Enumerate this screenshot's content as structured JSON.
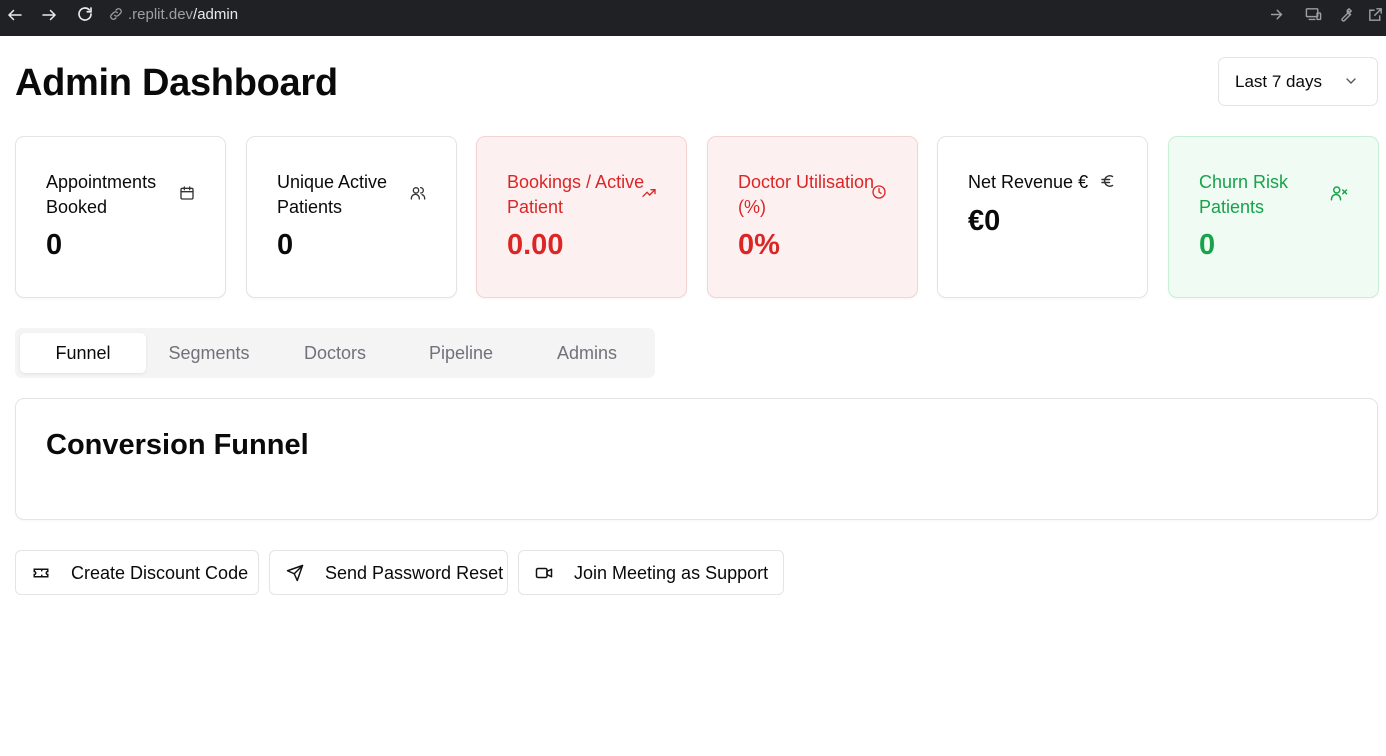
{
  "browser": {
    "url_host": ".replit.dev",
    "url_path": "/admin"
  },
  "header": {
    "title": "Admin Dashboard",
    "range": "Last 7 days"
  },
  "cards": [
    {
      "label": "Appointments Booked",
      "value": "0",
      "icon": "calendar-icon",
      "tone": "neutral"
    },
    {
      "label": "Unique Active Patients",
      "value": "0",
      "icon": "users-icon",
      "tone": "neutral"
    },
    {
      "label": "Bookings / Active Patient",
      "value": "0.00",
      "icon": "trending-up-icon",
      "tone": "red"
    },
    {
      "label": "Doctor Utilisation (%)",
      "value": "0%",
      "icon": "clock-icon",
      "tone": "red"
    },
    {
      "label": "Net Revenue €",
      "value": "€0",
      "icon": "euro-icon",
      "tone": "neutral"
    },
    {
      "label": "Churn Risk Patients",
      "value": "0",
      "icon": "user-x-icon",
      "tone": "green"
    }
  ],
  "tabs": [
    {
      "label": "Funnel",
      "active": true
    },
    {
      "label": "Segments",
      "active": false
    },
    {
      "label": "Doctors",
      "active": false
    },
    {
      "label": "Pipeline",
      "active": false
    },
    {
      "label": "Admins",
      "active": false
    }
  ],
  "funnel": {
    "title": "Conversion Funnel"
  },
  "actions": [
    {
      "label": "Create Discount Code",
      "icon": "ticket-icon"
    },
    {
      "label": "Send Password Reset",
      "icon": "send-icon"
    },
    {
      "label": "Join Meeting as Support",
      "icon": "video-icon"
    }
  ],
  "colors": {
    "red": "#dc2626",
    "red_bg": "#fdf0f0",
    "green": "#16a34a",
    "green_bg": "#effbf3",
    "border": "#e4e4e7"
  }
}
